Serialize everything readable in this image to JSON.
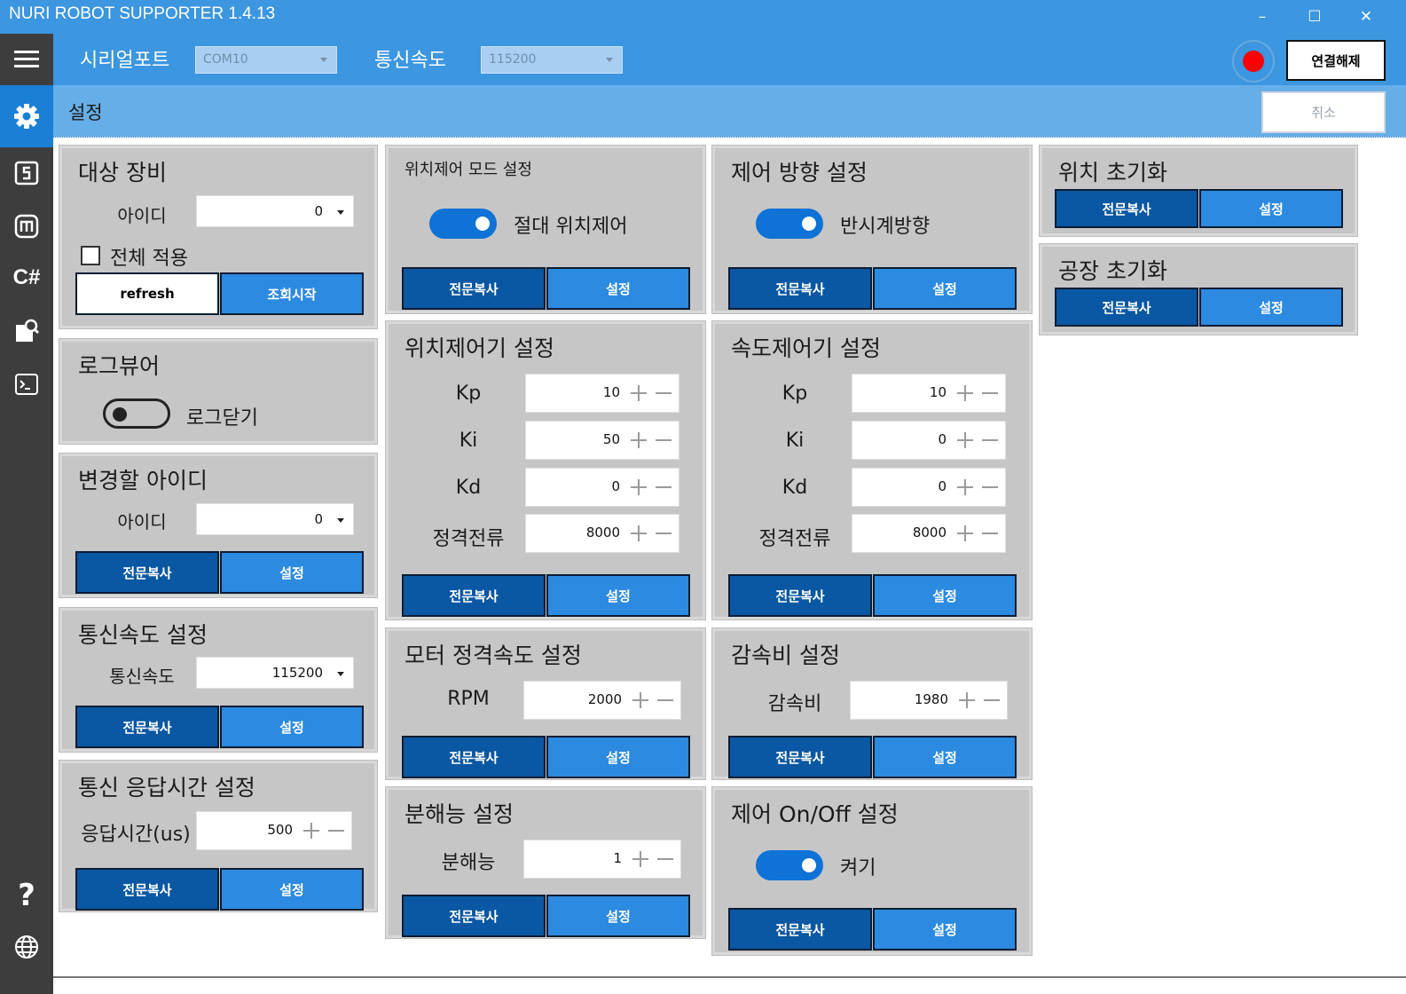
{
  "app": {
    "title": "NURI ROBOT SUPPORTER 1.4.13"
  },
  "window_controls": {
    "minimize": "–",
    "maximize": "☐",
    "close": "✕"
  },
  "toolbar": {
    "serial_label": "시리얼포트",
    "serial_value": "COM10",
    "baud_label": "통신속도",
    "baud_value": "115200",
    "disconnect_label": "연결해제",
    "record_color": "#ff0000"
  },
  "subbar": {
    "title": "설정",
    "cancel_label": "취소"
  },
  "sidebar": {
    "items": [
      "menu-icon",
      "gear-icon",
      "speedo-s-icon",
      "mecha-m-icon",
      "csharp-icon",
      "document-search-icon",
      "terminal-icon",
      "help-icon",
      "globe-icon"
    ],
    "csharp_text": "C#",
    "help_text": "?"
  },
  "common": {
    "copy_label": "전문복사",
    "set_label": "설정"
  },
  "target": {
    "title": "대상 장비",
    "id_label": "아이디",
    "id_value": "0",
    "apply_all_label": "전체 적용",
    "refresh_label": "refresh",
    "scan_label": "조회시작"
  },
  "logviewer": {
    "title": "로그뷰어",
    "toggle_label": "로그닫기",
    "toggle_on": false
  },
  "change_id": {
    "title": "변경할 아이디",
    "id_label": "아이디",
    "id_value": "0"
  },
  "baud_setting": {
    "title": "통신속도 설정",
    "label": "통신속도",
    "value": "115200"
  },
  "response_time": {
    "title": "통신 응답시간 설정",
    "label": "응답시간(us)",
    "value": "500"
  },
  "position_mode": {
    "title": "위치제어 모드 설정",
    "toggle_label": "절대 위치제어",
    "toggle_on": true
  },
  "position_ctrl": {
    "title": "위치제어기 설정",
    "kp_label": "Kp",
    "kp": "10",
    "ki_label": "Ki",
    "ki": "50",
    "kd_label": "Kd",
    "kd": "0",
    "current_label": "정격전류",
    "current": "8000"
  },
  "motor_speed": {
    "title": "모터 정격속도 설정",
    "label": "RPM",
    "value": "2000"
  },
  "resolution": {
    "title": "분해능 설정",
    "label": "분해능",
    "value": "1"
  },
  "direction": {
    "title": "제어 방향 설정",
    "toggle_label": "반시계방향",
    "toggle_on": true
  },
  "speed_ctrl": {
    "title": "속도제어기 설정",
    "kp_label": "Kp",
    "kp": "10",
    "ki_label": "Ki",
    "ki": "0",
    "kd_label": "Kd",
    "kd": "0",
    "current_label": "정격전류",
    "current": "8000"
  },
  "gear_ratio": {
    "title": "감속비 설정",
    "label": "감속비",
    "value": "1980"
  },
  "onoff": {
    "title": "제어 On/Off 설정",
    "toggle_label": "켜기",
    "toggle_on": true
  },
  "pos_init": {
    "title": "위치 초기화"
  },
  "factory_init": {
    "title": "공장 초기화"
  }
}
